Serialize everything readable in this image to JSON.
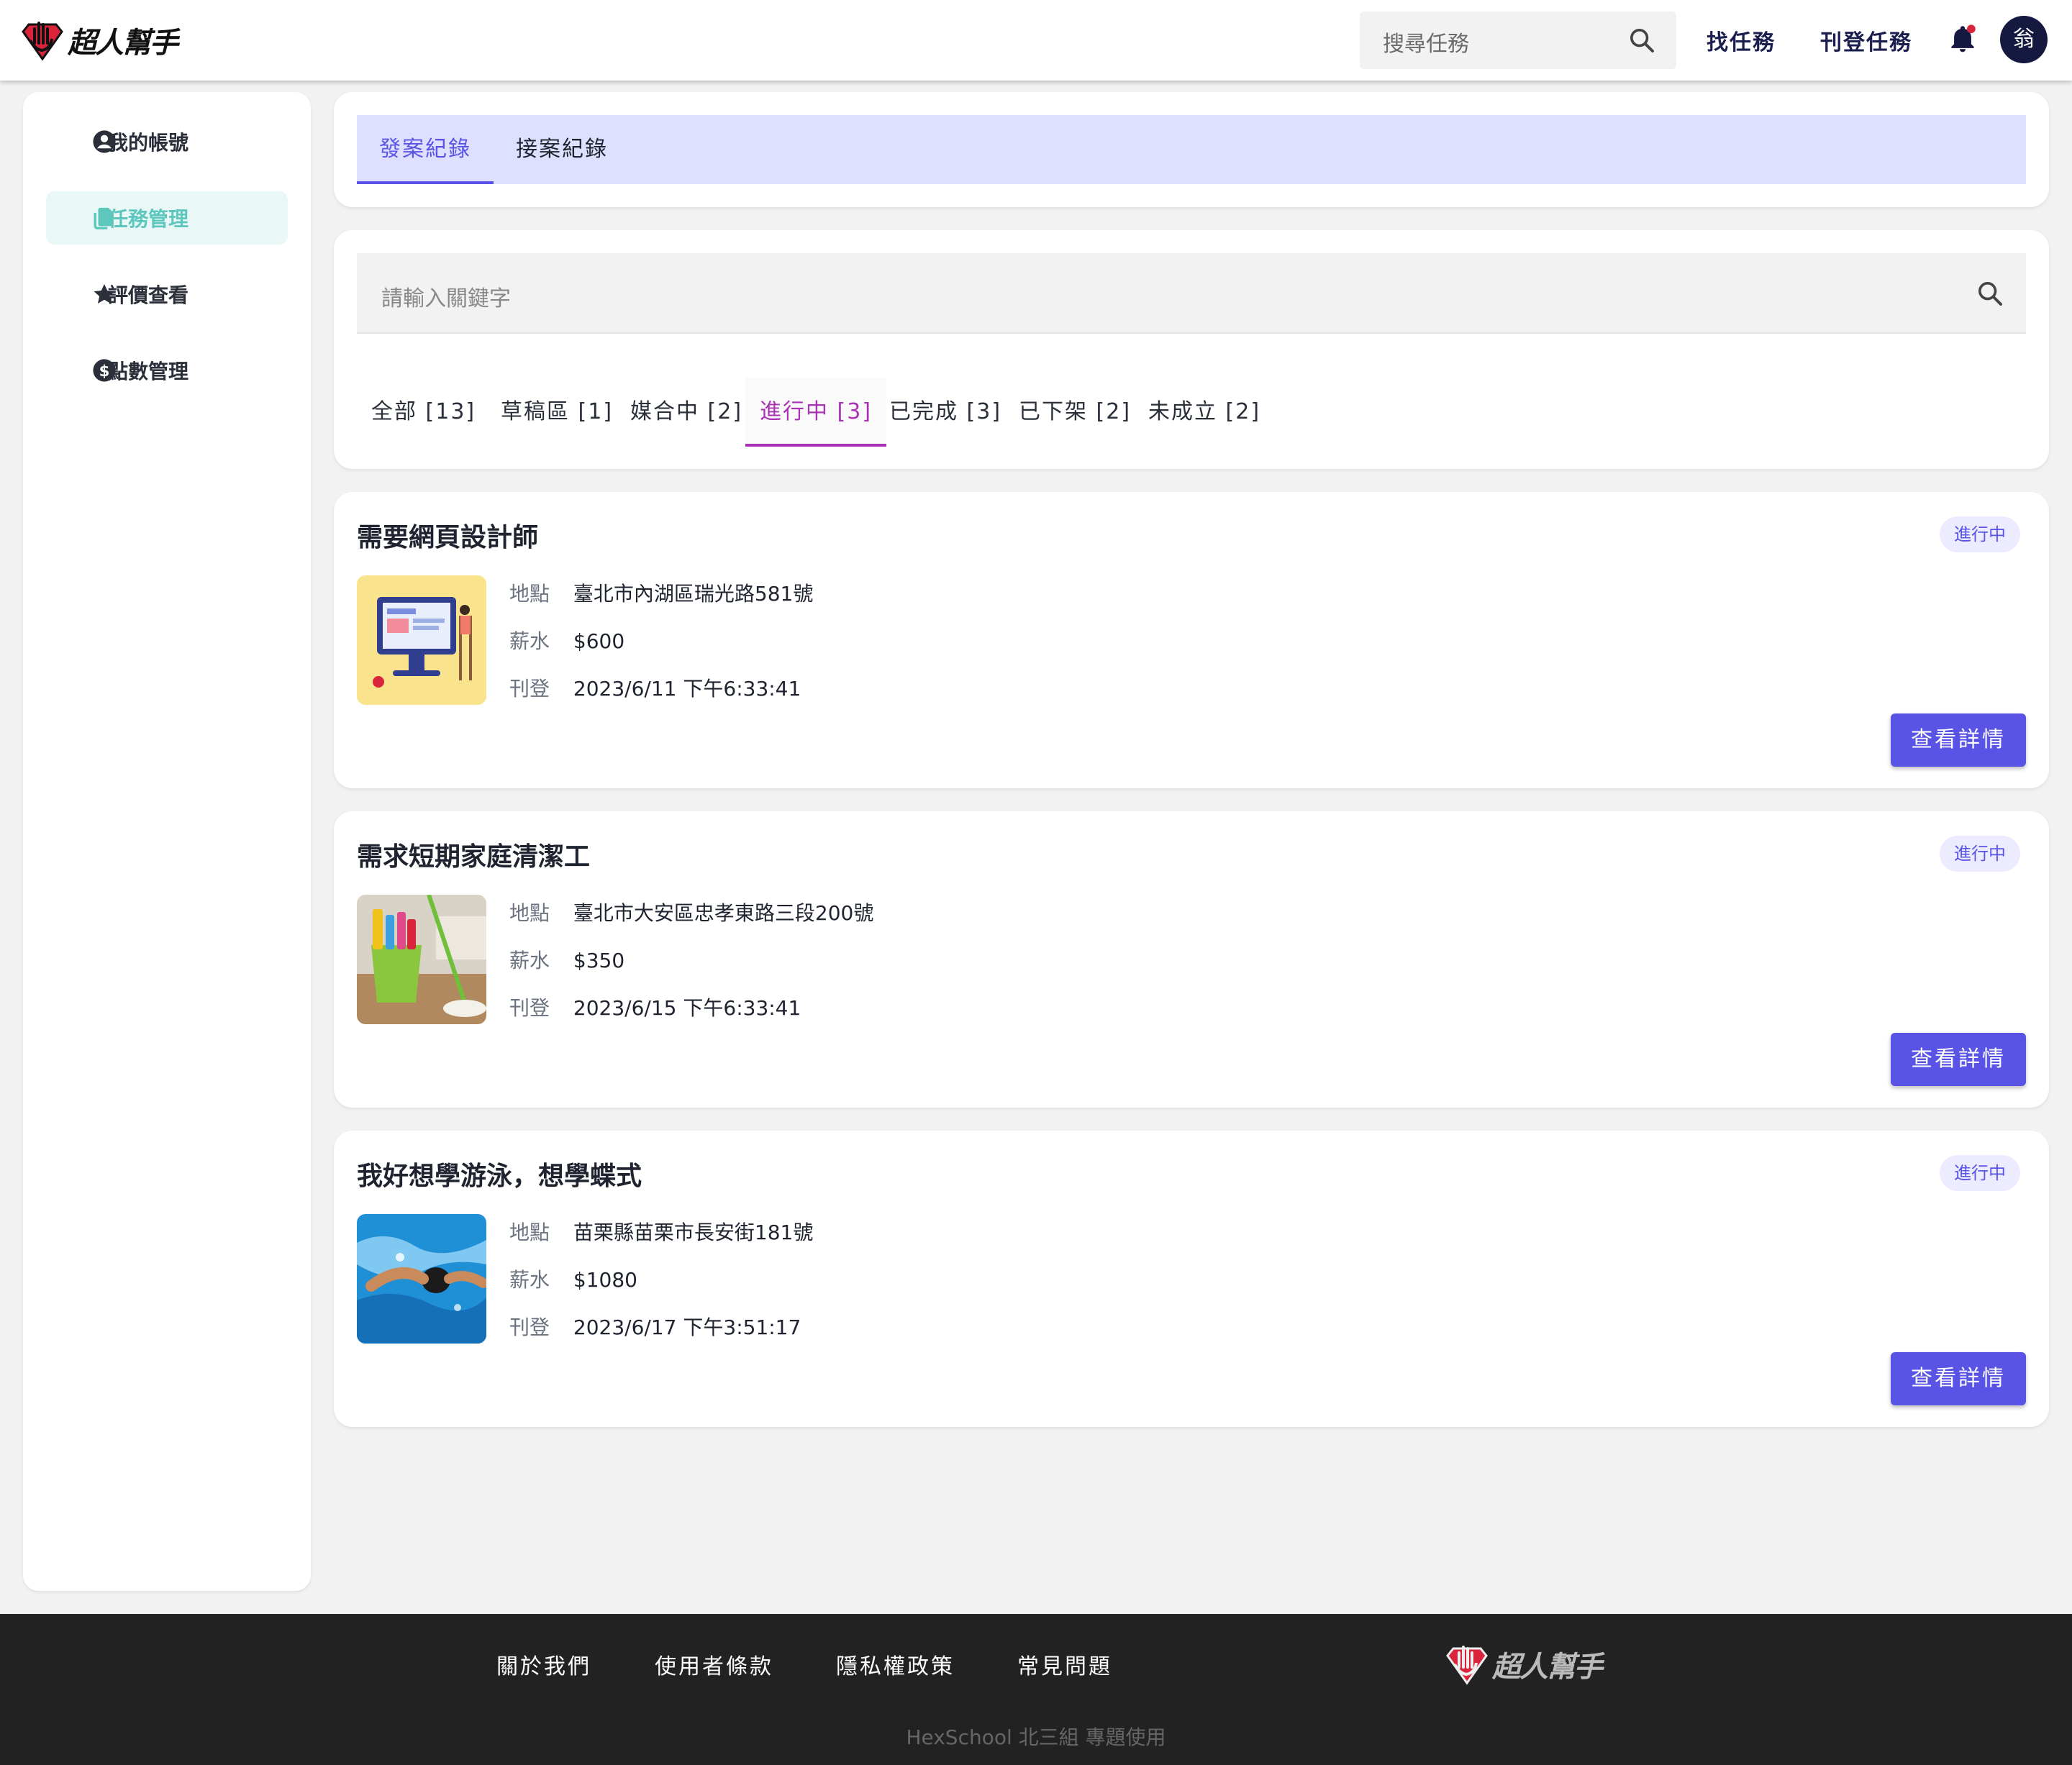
{
  "brand": {
    "name": "超人幫手"
  },
  "header": {
    "search_placeholder": "搜尋任務",
    "nav": [
      "找任務",
      "刊登任務"
    ],
    "avatar_initial": "翁"
  },
  "sidebar": {
    "items": [
      {
        "label": "我的帳號",
        "icon": "user-circle-icon"
      },
      {
        "label": "任務管理",
        "icon": "documents-icon",
        "active": true
      },
      {
        "label": "評價查看",
        "icon": "star-icon"
      },
      {
        "label": "點數管理",
        "icon": "dollar-circle-icon"
      }
    ]
  },
  "record_tabs": {
    "items": [
      "發案紀錄",
      "接案紀錄"
    ],
    "active": "發案紀錄"
  },
  "filter": {
    "placeholder": "請輸入關鍵字",
    "statuses": [
      "全部 [13]",
      "草稿區 [1]",
      "媒合中 [2]",
      "進行中 [3]",
      "已完成 [3]",
      "已下架 [2]",
      "未成立 [2]"
    ],
    "active": "進行中 [3]"
  },
  "labels": {
    "location": "地點",
    "salary": "薪水",
    "posted": "刊登",
    "detail_button": "查看詳情"
  },
  "tasks": [
    {
      "title": "需要網頁設計師",
      "status": "進行中",
      "location": "臺北市內湖區瑞光路581號",
      "salary": "$600",
      "posted": "2023/6/11 下午6:33:41"
    },
    {
      "title": "需求短期家庭清潔工",
      "status": "進行中",
      "location": "臺北市大安區忠孝東路三段200號",
      "salary": "$350",
      "posted": "2023/6/15 下午6:33:41"
    },
    {
      "title": "我好想學游泳，想學蝶式",
      "status": "進行中",
      "location": "苗栗縣苗栗市長安街181號",
      "salary": "$1080",
      "posted": "2023/6/17 下午3:51:17"
    }
  ],
  "footer": {
    "links": [
      "關於我們",
      "使用者條款",
      "隱私權政策",
      "常見問題"
    ],
    "copyright": "HexSchool 北三組 專題使用"
  },
  "colors": {
    "primary": "#5a54e6",
    "sidebar_active": "#5ec7bd",
    "filter_active": "#a932b5",
    "header_text": "#1b1f4d"
  }
}
